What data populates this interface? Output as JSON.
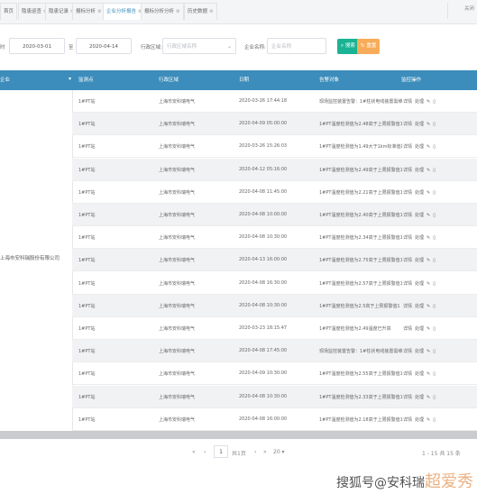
{
  "tabs": [
    {
      "label": "首页",
      "active": false,
      "has_close": false
    },
    {
      "label": "隐患巡查",
      "active": false,
      "has_close": true
    },
    {
      "label": "隐患记录",
      "active": false,
      "has_close": true
    },
    {
      "label": "报标分析",
      "active": false,
      "has_close": true
    },
    {
      "label": "企业分析报告",
      "active": true,
      "has_close": true
    },
    {
      "label": "报标分析分析",
      "active": false,
      "has_close": true
    },
    {
      "label": "历史数据",
      "active": false,
      "has_close": true
    }
  ],
  "tab_close_other": "关闭",
  "filters": {
    "start_label": "时",
    "start_date": "2020-03-01",
    "end_label": "至",
    "end_date": "2020-04-14",
    "region_label": "行政区域:",
    "region_placeholder": "行政区域名称",
    "company_label": "企业名称:",
    "company_placeholder": "企业名称",
    "search_button": "搜索",
    "reset_button": "重置"
  },
  "table": {
    "headers": [
      "企业",
      "监测点",
      "行政区域",
      "日期",
      "告警对象",
      "监控操作"
    ],
    "group_value": "上海市安科瑞股份有限公司",
    "rows": [
      {
        "station": "1#PT站",
        "company": "上海市安科瑞电气",
        "date": "2020-03-26 17:44:18",
        "alarm": "现场监控装置告警：1#柱状电线装置需维修",
        "ops": [
          "详情",
          "处理"
        ]
      },
      {
        "station": "1#PT站",
        "company": "上海市安科瑞电气",
        "date": "2020-04-09 05:00:00",
        "alarm": "1#PT温度检测值为2.48高于上限报警值1",
        "ops": [
          "详情",
          "处理"
        ]
      },
      {
        "station": "1#PT站",
        "company": "上海市安科瑞电气",
        "date": "2020-03-26 15:26:03",
        "alarm": "1#PT温度检测值为1.49大于1km标准值的",
        "ops": [
          "详情",
          "处理"
        ]
      },
      {
        "station": "1#PT站",
        "company": "上海市安科瑞电气",
        "date": "2020-04-12 05:16:00",
        "alarm": "1#PT温度检测值为2.49高于上限报警值1",
        "ops": [
          "详情",
          "处理"
        ]
      },
      {
        "station": "1#PT站",
        "company": "上海市安科瑞电气",
        "date": "2020-04-08 11:45:00",
        "alarm": "1#PT温度检测值为2.21高于上限报警值1",
        "ops": [
          "详情",
          "处理"
        ]
      },
      {
        "station": "1#PT站",
        "company": "上海市安科瑞电气",
        "date": "2020-04-08 10:00:00",
        "alarm": "1#PT温度检测值为2.40高于上限报警值1",
        "ops": [
          "详情",
          "处理"
        ]
      },
      {
        "station": "1#PT站",
        "company": "上海市安科瑞电气",
        "date": "2020-04-08 10:30:00",
        "alarm": "1#PT温度检测值为2.34高于上限报警值1",
        "ops": [
          "详情",
          "处理"
        ]
      },
      {
        "station": "1#PT站",
        "company": "上海市安科瑞电气",
        "date": "2020-04-13 16:00:00",
        "alarm": "1#PT温度检测值为2.75高于上限报警值1",
        "ops": [
          "详情",
          "处理"
        ]
      },
      {
        "station": "1#PT站",
        "company": "上海市安科瑞电气",
        "date": "2020-04-08 16:30:00",
        "alarm": "1#PT温度检测值为2.57高于上限报警值1",
        "ops": [
          "详情",
          "处理"
        ]
      },
      {
        "station": "1#PT站",
        "company": "上海市安科瑞电气",
        "date": "2020-04-08 10:30:00",
        "alarm": "1#PT温度检测值为2.5高于上限报警值1",
        "ops": [
          "详情",
          "处理"
        ]
      },
      {
        "station": "1#PT站",
        "company": "上海市安科瑞电气",
        "date": "2020-03-23 18:15:47",
        "alarm": "1#PT温度检测值为2.49温度已升高",
        "ops": [
          "详情",
          "处理"
        ]
      },
      {
        "station": "1#PT站",
        "company": "上海市安科瑞电气",
        "date": "2020-04-08 17:45:00",
        "alarm": "现场监控装置告警：1#柱状电线装置需维修",
        "ops": [
          "详情",
          "处理"
        ]
      },
      {
        "station": "1#PT站",
        "company": "上海市安科瑞电气",
        "date": "2020-04-09 10:30:00",
        "alarm": "1#PT温度检测值为2.55高于上限报警值1",
        "ops": [
          "详情",
          "处理"
        ]
      },
      {
        "station": "1#PT站",
        "company": "上海市安科瑞电气",
        "date": "2020-04-08 10:30:00",
        "alarm": "1#PT温度检测值为2.33高于上限报警值1",
        "ops": [
          "详情",
          "处理"
        ]
      },
      {
        "station": "1#PT站",
        "company": "上海市安科瑞电气",
        "date": "2020-04-08 16:00:00",
        "alarm": "1#PT温度检测值为2.18高于上限报警值1",
        "ops": [
          "详情",
          "处理"
        ]
      }
    ]
  },
  "pager": {
    "first": "«",
    "prev": "‹",
    "current_page": "1",
    "total_pages": "共1页",
    "next": "›",
    "last": "»",
    "page_size": "20",
    "summary": "1 - 15 共 15 条"
  },
  "watermark": {
    "prefix": "搜狐号@安科瑞",
    "suffix": "超爱秀"
  },
  "colors": {
    "header_blue": "#3c8dbc",
    "search_green": "#1ab394",
    "reset_orange": "#f8ac59"
  }
}
